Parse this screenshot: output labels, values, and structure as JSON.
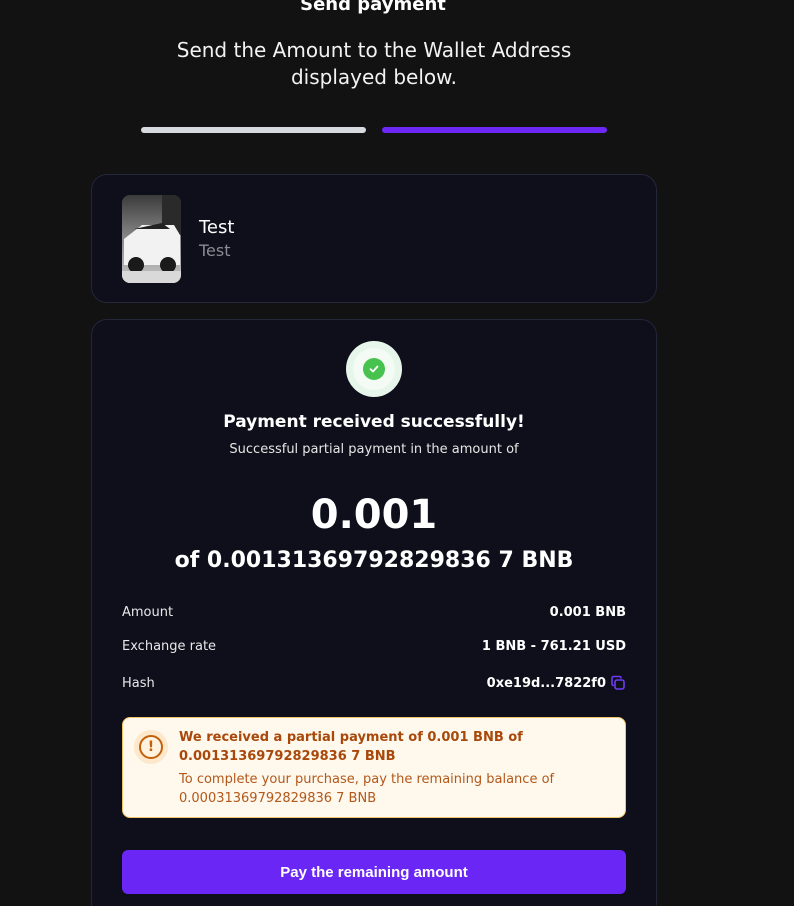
{
  "header": {
    "title": "Send payment",
    "subtitle": "Send the Amount to the Wallet Address displayed below."
  },
  "progress": {
    "total_steps": 2,
    "current_step": 2
  },
  "product": {
    "name": "Test",
    "subtitle": "Test",
    "image_icon": "product-thumbnail"
  },
  "status": {
    "icon": "check-circle-icon",
    "title": "Payment received successfully!",
    "description": "Successful partial payment in the amount of",
    "amount_received": "0.001",
    "amount_total": "of 0.00131369792829836 7 BNB"
  },
  "details": {
    "amount_label": "Amount",
    "amount_value": "0.001 BNB",
    "rate_label": "Exchange rate",
    "rate_value": "1 BNB - 761.21 USD",
    "hash_label": "Hash",
    "hash_value": "0xe19d...7822f0"
  },
  "warning": {
    "title": "We received a partial payment of 0.001 BNB of 0.00131369792829836 7 BNB",
    "text": "To complete your purchase, pay the remaining balance of 0.00031369792829836 7 BNB"
  },
  "button": {
    "pay_label": "Pay the remaining amount"
  },
  "colors": {
    "accent": "#6a26f5",
    "success": "#47c24f",
    "warning_text": "#a8480a"
  }
}
